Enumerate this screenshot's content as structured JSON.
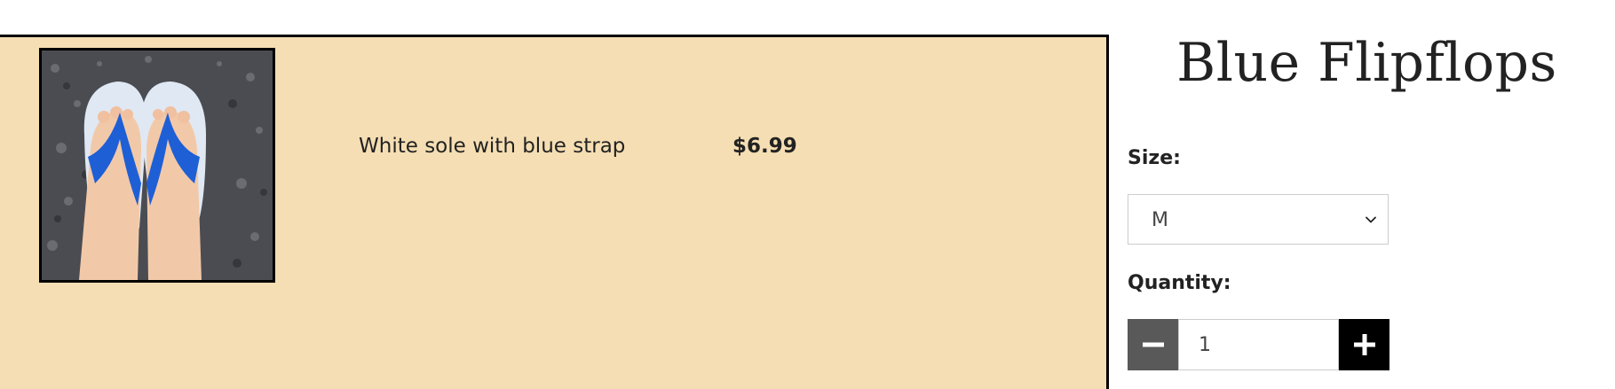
{
  "product": {
    "title": "Blue Flipflops",
    "description": "White sole with blue strap",
    "price": "$6.99",
    "image_icon": "flipflops-photo"
  },
  "options": {
    "size_label": "Size:",
    "size_selected": "M",
    "quantity_label": "Quantity:",
    "quantity_value": "1"
  },
  "colors": {
    "panel_bg": "#f5deb3",
    "minus_bg": "#595959",
    "plus_bg": "#000000",
    "strap_blue": "#1e5fd6"
  },
  "icons": {
    "size_dropdown": "chevron-down-icon",
    "decrease": "minus-icon",
    "increase": "plus-icon"
  }
}
